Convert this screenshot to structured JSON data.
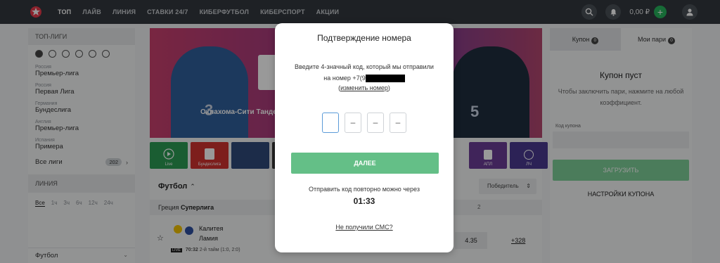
{
  "nav": {
    "items": [
      "ТОП",
      "ЛАЙВ",
      "ЛИНИЯ",
      "СТАВКИ 24/7",
      "КИБЕРФУТБОЛ",
      "КИБЕРСПОРТ",
      "АКЦИИ"
    ],
    "active_index": 0,
    "balance": "0,00 ₽",
    "plus_label": "+"
  },
  "sidebar": {
    "top_leagues_title": "ТОП-ЛИГИ",
    "leagues": [
      {
        "country": "Россия",
        "name": "Премьер-лига"
      },
      {
        "country": "Россия",
        "name": "Первая Лига"
      },
      {
        "country": "Германия",
        "name": "Бундеслига"
      },
      {
        "country": "Англия",
        "name": "Премьер-лига"
      },
      {
        "country": "Испания",
        "name": "Примера"
      }
    ],
    "all_leagues_label": "Все лиги",
    "all_leagues_count": "202",
    "line_title": "ЛИНИЯ",
    "periods": [
      "Все",
      "1ч",
      "3ч",
      "6ч",
      "12ч",
      "24ч"
    ],
    "sport_label": "Футбол"
  },
  "main": {
    "banner_text": "Оклахома-Сити Тандер",
    "right_jersey": "5",
    "left_jersey": "3",
    "tiles": [
      {
        "label": "Live",
        "color": "#2c9b54"
      },
      {
        "label": "Бундеслига",
        "color": "#d1322f"
      },
      {
        "label": "",
        "color": "#2f4a7a"
      },
      {
        "label": "",
        "color": "#3a3a3a"
      }
    ],
    "tiles_right": [
      {
        "label": "",
        "color": "#3b63c8"
      },
      {
        "label": "АПЛ",
        "color": "#6b3d96"
      },
      {
        "label": "ЛЧ",
        "color": "#4a3a8f"
      }
    ],
    "sport_title": "Футбол",
    "sort_label": "Победитель",
    "league_row": {
      "country": "Греция",
      "name": "Суперлига"
    },
    "col_head": "2",
    "match": {
      "team1": "Калитея",
      "team2": "Ламия",
      "live": "LIVE",
      "time": "70:32",
      "period": "2-й тайм (1:0, 2:0)",
      "odd": "4.35",
      "more": "+328"
    }
  },
  "coupon": {
    "tab_coupon": "Купон",
    "tab_coupon_count": "0",
    "tab_bets": "Мои пари",
    "tab_bets_count": "0",
    "empty_title": "Купон пуст",
    "empty_desc": "Чтобы заключить пари, нажмите на любой коэффициент.",
    "code_label": "Код купона",
    "load_label": "ЗАГРУЗИТЬ",
    "settings_label": "НАСТРОЙКИ КУПОНА"
  },
  "modal": {
    "title": "Подтверждение номера",
    "desc": "Введите 4-значный код, который мы отправили на номер +7(9",
    "change_label": "изменить номер",
    "digits": [
      "",
      "–",
      "–",
      "–"
    ],
    "next_label": "ДАЛЕЕ",
    "resend_text": "Отправить код повторно можно через",
    "timer": "01:33",
    "no_sms_label": "Не получили СМС?"
  },
  "colors": {
    "topbar": "#33383e",
    "accent_green": "#64bf87",
    "brand_red": "#e8394a"
  },
  "icons": [
    "logo-icon",
    "search-icon",
    "bell-icon",
    "user-icon",
    "football-icon",
    "hockey-icon",
    "basketball-icon",
    "tennis-icon",
    "gamepad-icon",
    "star-icon"
  ]
}
